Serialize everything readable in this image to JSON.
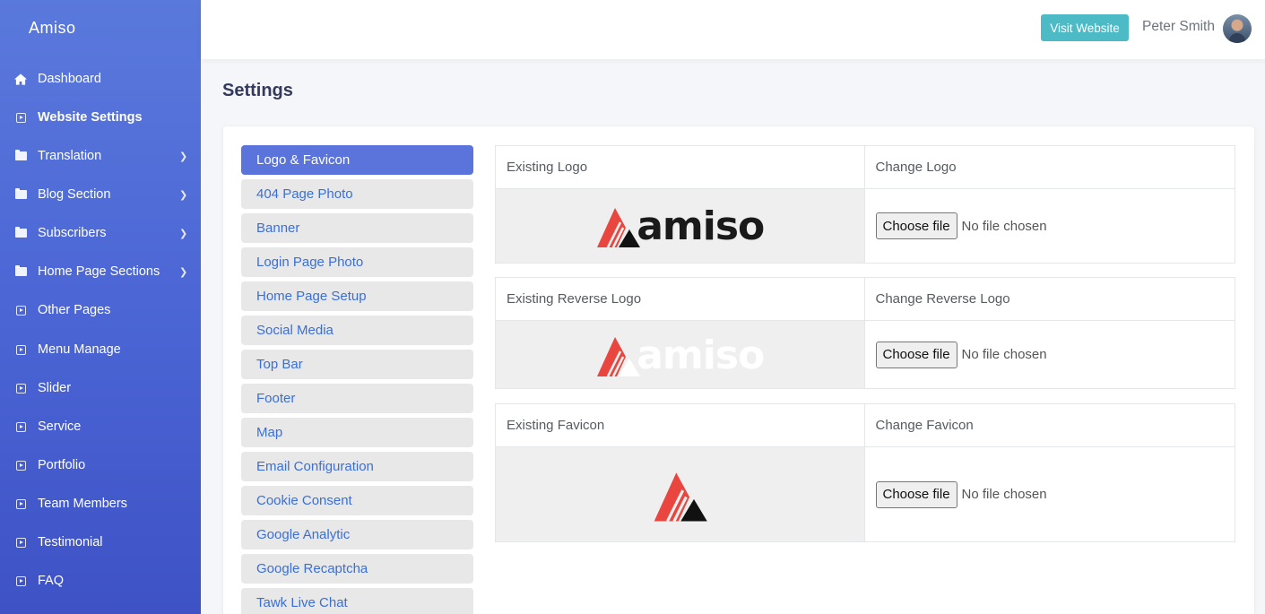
{
  "app": {
    "brand": "Amiso"
  },
  "sidebar": {
    "items": [
      {
        "label": "Dashboard",
        "icon": "home-icon",
        "has_children": false,
        "active": false
      },
      {
        "label": "Website Settings",
        "icon": "square-arrow-icon",
        "has_children": false,
        "active": true
      },
      {
        "label": "Translation",
        "icon": "folder-icon",
        "has_children": true,
        "active": false
      },
      {
        "label": "Blog Section",
        "icon": "folder-icon",
        "has_children": true,
        "active": false
      },
      {
        "label": "Subscribers",
        "icon": "folder-icon",
        "has_children": true,
        "active": false
      },
      {
        "label": "Home Page Sections",
        "icon": "folder-icon",
        "has_children": true,
        "active": false
      },
      {
        "label": "Other Pages",
        "icon": "square-arrow-icon",
        "has_children": false,
        "active": false
      },
      {
        "label": "Menu Manage",
        "icon": "square-arrow-icon",
        "has_children": false,
        "active": false
      },
      {
        "label": "Slider",
        "icon": "square-arrow-icon",
        "has_children": false,
        "active": false
      },
      {
        "label": "Service",
        "icon": "square-arrow-icon",
        "has_children": false,
        "active": false
      },
      {
        "label": "Portfolio",
        "icon": "square-arrow-icon",
        "has_children": false,
        "active": false
      },
      {
        "label": "Team Members",
        "icon": "square-arrow-icon",
        "has_children": false,
        "active": false
      },
      {
        "label": "Testimonial",
        "icon": "square-arrow-icon",
        "has_children": false,
        "active": false
      },
      {
        "label": "FAQ",
        "icon": "square-arrow-icon",
        "has_children": false,
        "active": false
      }
    ]
  },
  "header": {
    "visit_label": "Visit Website",
    "user_name": "Peter Smith"
  },
  "page": {
    "title": "Settings"
  },
  "settings_tabs": [
    {
      "label": "Logo & Favicon",
      "active": true
    },
    {
      "label": "404 Page Photo",
      "active": false
    },
    {
      "label": "Banner",
      "active": false
    },
    {
      "label": "Login Page Photo",
      "active": false
    },
    {
      "label": "Home Page Setup",
      "active": false
    },
    {
      "label": "Social Media",
      "active": false
    },
    {
      "label": "Top Bar",
      "active": false
    },
    {
      "label": "Footer",
      "active": false
    },
    {
      "label": "Map",
      "active": false
    },
    {
      "label": "Email Configuration",
      "active": false
    },
    {
      "label": "Cookie Consent",
      "active": false
    },
    {
      "label": "Google Analytic",
      "active": false
    },
    {
      "label": "Google Recaptcha",
      "active": false
    },
    {
      "label": "Tawk Live Chat",
      "active": false
    }
  ],
  "logo_tables": [
    {
      "existing_label": "Existing Logo",
      "change_label": "Change Logo",
      "logo_word": "amiso",
      "variant": "dark"
    },
    {
      "existing_label": "Existing Reverse Logo",
      "change_label": "Change Reverse Logo",
      "logo_word": "amiso",
      "variant": "light"
    },
    {
      "existing_label": "Existing Favicon",
      "change_label": "Change Favicon",
      "logo_word": "",
      "variant": "icon"
    }
  ],
  "file_input": {
    "button_label": "Choose file",
    "status": "No file chosen"
  },
  "colors": {
    "sidebar": "#4a64d4",
    "accent": "#5a74dc",
    "visit_button": "#4dbbc5",
    "logo_red": "#e8463f"
  }
}
